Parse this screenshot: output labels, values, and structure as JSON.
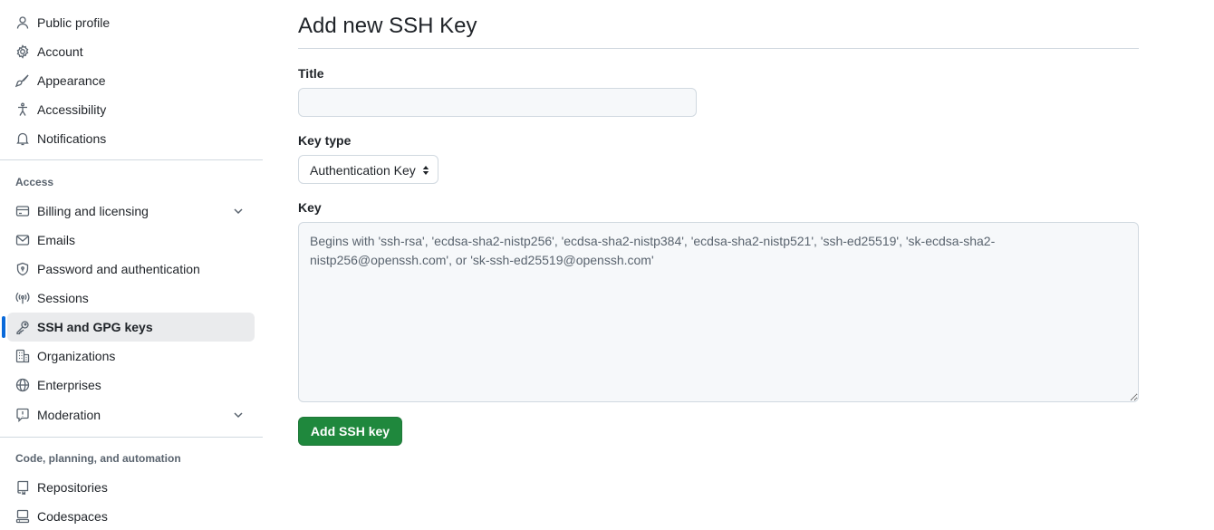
{
  "sidebar": {
    "items_top": [
      {
        "label": "Public profile",
        "icon": "person-icon"
      },
      {
        "label": "Account",
        "icon": "gear-icon"
      },
      {
        "label": "Appearance",
        "icon": "paintbrush-icon"
      },
      {
        "label": "Accessibility",
        "icon": "accessibility-icon"
      },
      {
        "label": "Notifications",
        "icon": "bell-icon"
      }
    ],
    "access_heading": "Access",
    "items_access": [
      {
        "label": "Billing and licensing",
        "icon": "credit-card-icon",
        "expandable": true
      },
      {
        "label": "Emails",
        "icon": "mail-icon"
      },
      {
        "label": "Password and authentication",
        "icon": "shield-lock-icon"
      },
      {
        "label": "Sessions",
        "icon": "broadcast-icon"
      },
      {
        "label": "SSH and GPG keys",
        "icon": "key-icon",
        "active": true
      },
      {
        "label": "Organizations",
        "icon": "organization-icon"
      },
      {
        "label": "Enterprises",
        "icon": "globe-icon"
      },
      {
        "label": "Moderation",
        "icon": "report-icon",
        "expandable": true
      }
    ],
    "code_heading": "Code, planning, and automation",
    "items_code": [
      {
        "label": "Repositories",
        "icon": "repo-icon"
      },
      {
        "label": "Codespaces",
        "icon": "codespaces-icon"
      }
    ]
  },
  "main": {
    "title": "Add new SSH Key",
    "title_field": {
      "label": "Title",
      "value": "",
      "placeholder": ""
    },
    "key_type": {
      "label": "Key type",
      "selected": "Authentication Key"
    },
    "key_field": {
      "label": "Key",
      "value": "",
      "placeholder": "Begins with 'ssh-rsa', 'ecdsa-sha2-nistp256', 'ecdsa-sha2-nistp384', 'ecdsa-sha2-nistp521', 'ssh-ed25519', 'sk-ecdsa-sha2-nistp256@openssh.com', or 'sk-ssh-ed25519@openssh.com'"
    },
    "submit_label": "Add SSH key"
  },
  "colors": {
    "accent": "#0969da",
    "primary_button": "#1f883d",
    "active_bg": "#eaebed",
    "border": "#d1d9e0"
  }
}
